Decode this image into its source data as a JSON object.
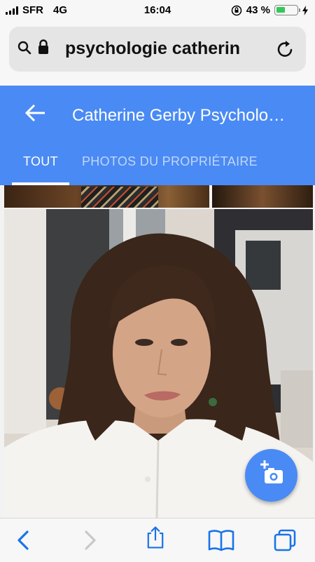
{
  "status_bar": {
    "carrier": "SFR",
    "network": "4G",
    "time": "16:04",
    "battery_percent": "43 %",
    "battery_level": 0.43
  },
  "browser": {
    "url": "psychologie catherin",
    "icons": [
      "search-icon",
      "lock-icon",
      "reload-icon"
    ]
  },
  "header": {
    "title": "Catherine Gerby Psycholo…",
    "accent_color": "#4a8af4",
    "tabs": [
      {
        "label": "TOUT",
        "active": true
      },
      {
        "label": "PHOTOS DU PROPRIÉTAIRE",
        "active": false
      }
    ]
  },
  "fab": {
    "icon": "add-photo-icon"
  },
  "toolbar": {
    "icons": [
      "back-icon",
      "forward-icon",
      "share-icon",
      "bookmarks-icon",
      "tabs-icon"
    ]
  }
}
